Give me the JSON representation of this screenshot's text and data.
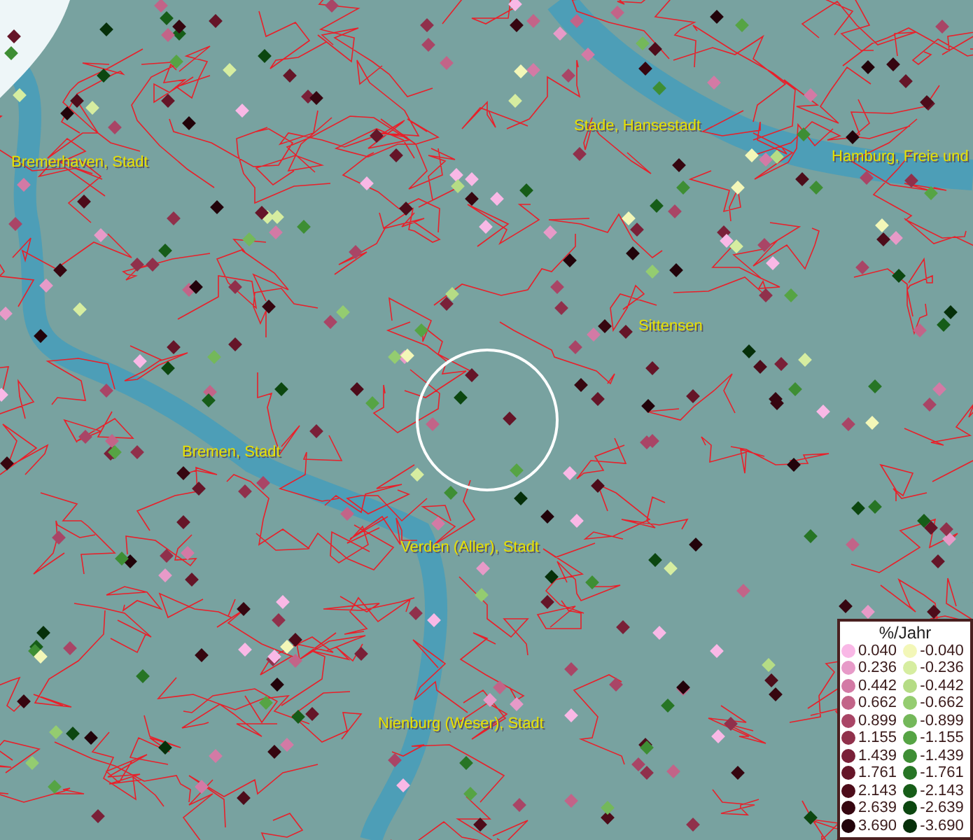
{
  "map": {
    "places": [
      {
        "name": "Bremerhaven, Stadt"
      },
      {
        "name": "Stade, Hansestadt"
      },
      {
        "name": "Hamburg, Freie und"
      },
      {
        "name": "Sittensen"
      },
      {
        "name": "Bremen, Stadt"
      },
      {
        "name": "Verden (Aller), Stadt"
      },
      {
        "name": "Nienburg (Weser), Stadt"
      }
    ]
  },
  "legend": {
    "title": "%/Jahr",
    "positive": [
      {
        "value": "0.040",
        "color": "#f9b8e6"
      },
      {
        "value": "0.236",
        "color": "#e79ac8"
      },
      {
        "value": "0.442",
        "color": "#d37aa5"
      },
      {
        "value": "0.662",
        "color": "#c26488"
      },
      {
        "value": "0.899",
        "color": "#a94566"
      },
      {
        "value": "1.155",
        "color": "#90304b"
      },
      {
        "value": "1.439",
        "color": "#7a2038"
      },
      {
        "value": "1.761",
        "color": "#651528"
      },
      {
        "value": "2.143",
        "color": "#4d0c1a"
      },
      {
        "value": "2.639",
        "color": "#360610"
      },
      {
        "value": "3.690",
        "color": "#22030a"
      }
    ],
    "negative": [
      {
        "value": "-0.040",
        "color": "#f3f7b8"
      },
      {
        "value": "-0.236",
        "color": "#d6eda0"
      },
      {
        "value": "-0.442",
        "color": "#b5dc85"
      },
      {
        "value": "-0.662",
        "color": "#94cc70"
      },
      {
        "value": "-0.899",
        "color": "#74b85a"
      },
      {
        "value": "-1.155",
        "color": "#56a444"
      },
      {
        "value": "-1.439",
        "color": "#3e8e34"
      },
      {
        "value": "-1.761",
        "color": "#277525"
      },
      {
        "value": "-2.143",
        "color": "#165d18"
      },
      {
        "value": "-2.639",
        "color": "#0c4710"
      },
      {
        "value": "-3.690",
        "color": "#06300a"
      }
    ]
  }
}
